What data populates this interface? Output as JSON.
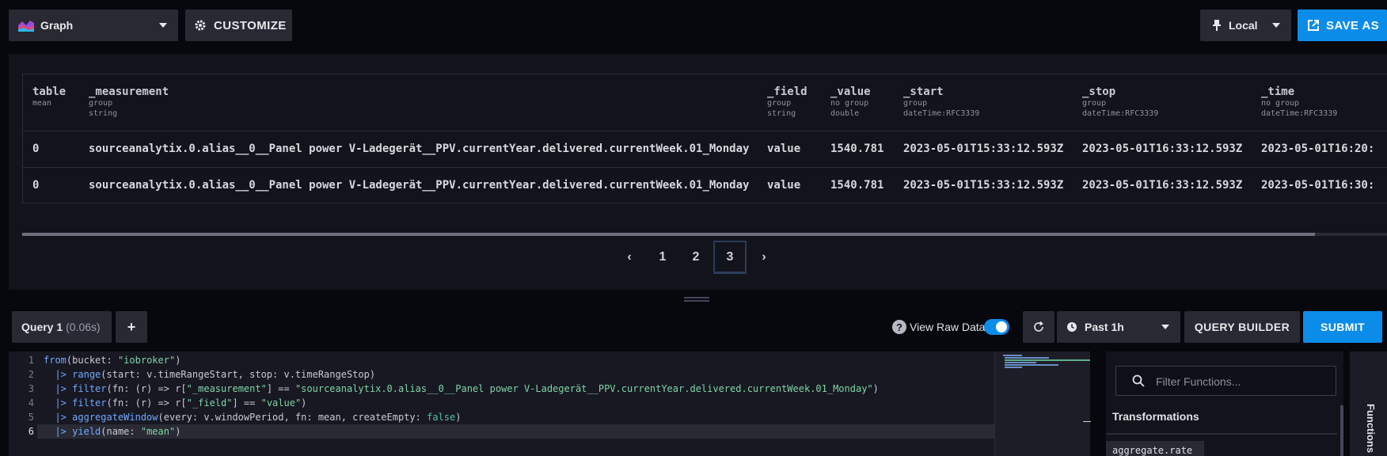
{
  "toolbar": {
    "graph_label": "Graph",
    "customize_label": "CUSTOMIZE",
    "local_label": "Local",
    "save_as_label": "SAVE AS"
  },
  "table": {
    "columns": [
      {
        "name": "table",
        "sub1": "mean",
        "sub2": ""
      },
      {
        "name": "_measurement",
        "sub1": "group",
        "sub2": "string"
      },
      {
        "name": "_field",
        "sub1": "group",
        "sub2": "string"
      },
      {
        "name": "_value",
        "sub1": "no group",
        "sub2": "double"
      },
      {
        "name": "_start",
        "sub1": "group",
        "sub2": "dateTime:RFC3339"
      },
      {
        "name": "_stop",
        "sub1": "group",
        "sub2": "dateTime:RFC3339"
      },
      {
        "name": "_time",
        "sub1": "no group",
        "sub2": "dateTime:RFC3339"
      }
    ],
    "rows": [
      [
        "0",
        "sourceanalytix.0.alias__0__Panel power V-Ladegerät__PPV.currentYear.delivered.currentWeek.01_Monday",
        "value",
        "1540.781",
        "2023-05-01T15:33:12.593Z",
        "2023-05-01T16:33:12.593Z",
        "2023-05-01T16:20:"
      ],
      [
        "0",
        "sourceanalytix.0.alias__0__Panel power V-Ladegerät__PPV.currentYear.delivered.currentWeek.01_Monday",
        "value",
        "1540.781",
        "2023-05-01T15:33:12.593Z",
        "2023-05-01T16:33:12.593Z",
        "2023-05-01T16:30:"
      ]
    ],
    "horizontal_scroll_position": 0.947
  },
  "pagination": {
    "prev": "‹",
    "pages": [
      "1",
      "2",
      "3"
    ],
    "current_page": "3",
    "next": "›"
  },
  "query_bar": {
    "query_name": "Query 1",
    "query_time": "(0.06s)",
    "add_label": "+",
    "help_label": "?",
    "view_raw_label": "View Raw Data",
    "view_raw_enabled": true,
    "time_range_label": "Past 1h",
    "query_builder_label": "QUERY BUILDER",
    "submit_label": "SUBMIT"
  },
  "editor": {
    "line_numbers": [
      "1",
      "2",
      "3",
      "4",
      "5",
      "6"
    ],
    "current_line": "6",
    "code": [
      "from(bucket: \"iobroker\")",
      "  |> range(start: v.timeRangeStart, stop: v.timeRangeStop)",
      "  |> filter(fn: (r) => r[\"_measurement\"] == \"sourceanalytix.0.alias__0__Panel power V-Ladegerät__PPV.currentYear.delivered.currentWeek.01_Monday\")",
      "  |> filter(fn: (r) => r[\"_field\"] == \"value\")",
      "  |> aggregateWindow(every: v.windowPeriod, fn: mean, createEmpty: false)",
      "  |> yield(name: \"mean\")"
    ]
  },
  "functions_panel": {
    "search_placeholder": "Filter Functions...",
    "category": "Transformations",
    "first_item": "aggregate.rate",
    "tab_label": "Functions"
  },
  "colors": {
    "accent": "#0c8ce9",
    "button_dark": "#292933",
    "panel": "#13131c",
    "background": "#07070e"
  }
}
